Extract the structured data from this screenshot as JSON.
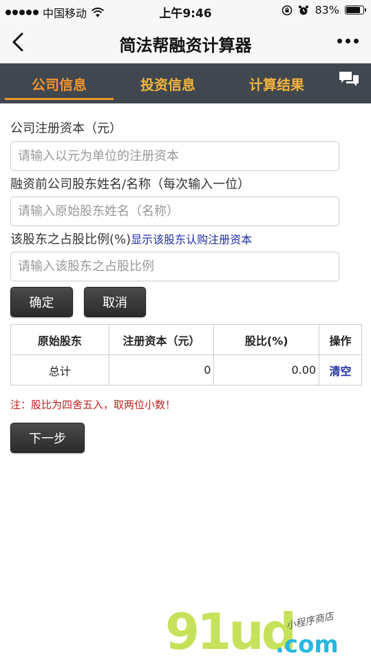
{
  "status_bar": {
    "carrier": "中国移动",
    "time": "上午9:46",
    "battery": "83%",
    "battery_level": 0.83
  },
  "nav": {
    "title": "简法帮融资计算器"
  },
  "tabs": [
    {
      "label": "公司信息",
      "active": true
    },
    {
      "label": "投资信息",
      "active": false
    },
    {
      "label": "计算结果",
      "active": false
    }
  ],
  "form": {
    "capital_label": "公司注册资本（元）",
    "capital_placeholder": "请输入以元为单位的注册资本",
    "shareholder_label": "融资前公司股东姓名/名称（每次输入一位）",
    "shareholder_placeholder": "请输入原始股东姓名（名称）",
    "ratio_label": "该股东之占股比例(%)",
    "ratio_link": "显示该股东认购注册资本",
    "ratio_placeholder": "请输入该股东之占股比例",
    "confirm_label": "确定",
    "cancel_label": "取消"
  },
  "table": {
    "headers": [
      "原始股东",
      "注册资本（元）",
      "股比(%)",
      "操作"
    ],
    "total_row": {
      "name": "总计",
      "capital": "0",
      "ratio": "0.00",
      "action": "清空"
    }
  },
  "note": "注：股比为四舍五入，取两位小数！",
  "next_label": "下一步",
  "watermark": {
    "logo": "91ud",
    "domain": ".com",
    "tagline": "小程序商店"
  },
  "colors": {
    "tab_bar_bg": "#41474f",
    "tab_text": "#f2b43c",
    "link": "#1f2fa6",
    "note": "#c0201f",
    "button_bg": "#2b2b2b"
  }
}
